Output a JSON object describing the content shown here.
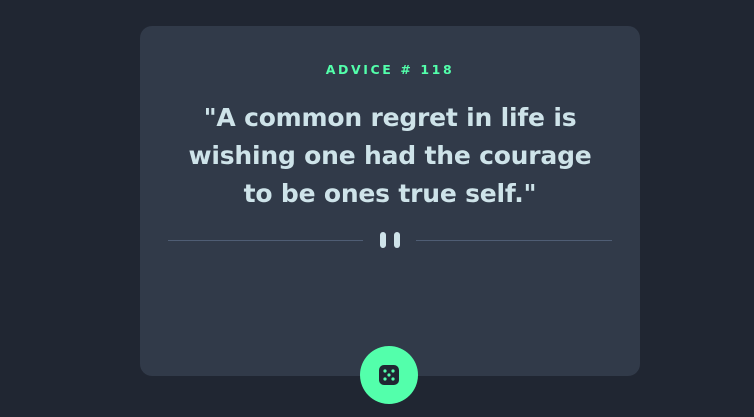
{
  "advice": {
    "label": "ADVICE # 118",
    "quote": "\"A common regret in life is wishing one had the courage to be ones true self.\""
  },
  "icons": {
    "divider": "pause-icon",
    "button": "dice-icon"
  },
  "colors": {
    "background": "#202632",
    "card": "#313a49",
    "accent": "#53ffab",
    "text": "#cee3e9",
    "divider": "#4f5d74"
  }
}
